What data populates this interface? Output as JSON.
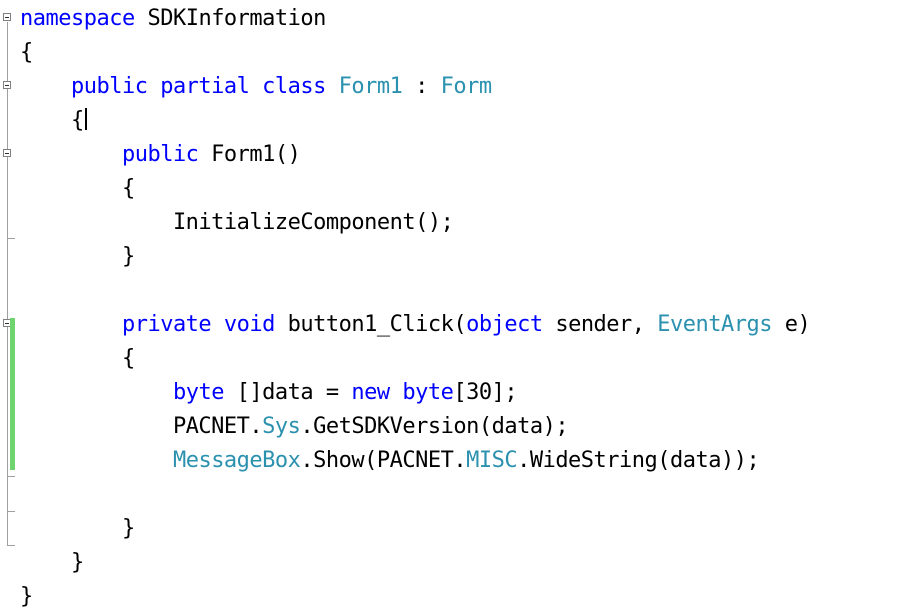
{
  "editor": {
    "lines": [
      {
        "segments": [
          {
            "text": "namespace",
            "kind": "keyword"
          },
          {
            "text": " SDKInformation",
            "kind": "plain"
          }
        ]
      },
      {
        "segments": [
          {
            "text": "{",
            "kind": "plain"
          }
        ]
      },
      {
        "segments": [
          {
            "text": "    public partial class ",
            "kind": "keyword"
          },
          {
            "text": "Form1",
            "kind": "type"
          },
          {
            "text": " : ",
            "kind": "plain"
          },
          {
            "text": "Form",
            "kind": "type"
          }
        ]
      },
      {
        "segments": [
          {
            "text": "    {",
            "kind": "plain"
          }
        ],
        "cursor": true
      },
      {
        "segments": [
          {
            "text": "        public",
            "kind": "keyword"
          },
          {
            "text": " Form1()",
            "kind": "plain"
          }
        ]
      },
      {
        "segments": [
          {
            "text": "        {",
            "kind": "plain"
          }
        ]
      },
      {
        "segments": [
          {
            "text": "            InitializeComponent();",
            "kind": "plain"
          }
        ]
      },
      {
        "segments": [
          {
            "text": "        }",
            "kind": "plain"
          }
        ]
      },
      {
        "segments": [
          {
            "text": "",
            "kind": "plain"
          }
        ]
      },
      {
        "segments": [
          {
            "text": "        private void",
            "kind": "keyword"
          },
          {
            "text": " button1_Click(",
            "kind": "plain"
          },
          {
            "text": "object",
            "kind": "keyword"
          },
          {
            "text": " sender, ",
            "kind": "plain"
          },
          {
            "text": "EventArgs",
            "kind": "type"
          },
          {
            "text": " e)",
            "kind": "plain"
          }
        ]
      },
      {
        "segments": [
          {
            "text": "        {",
            "kind": "plain"
          }
        ]
      },
      {
        "segments": [
          {
            "text": "            ",
            "kind": "plain"
          },
          {
            "text": "byte",
            "kind": "keyword"
          },
          {
            "text": " []data = ",
            "kind": "plain"
          },
          {
            "text": "new byte",
            "kind": "keyword"
          },
          {
            "text": "[30];",
            "kind": "plain"
          }
        ]
      },
      {
        "segments": [
          {
            "text": "            PACNET.",
            "kind": "plain"
          },
          {
            "text": "Sys",
            "kind": "type"
          },
          {
            "text": ".GetSDKVersion(data);",
            "kind": "plain"
          }
        ]
      },
      {
        "segments": [
          {
            "text": "            ",
            "kind": "plain"
          },
          {
            "text": "MessageBox",
            "kind": "type"
          },
          {
            "text": ".Show(PACNET.",
            "kind": "plain"
          },
          {
            "text": "MISC",
            "kind": "type"
          },
          {
            "text": ".WideString(data));",
            "kind": "plain"
          }
        ]
      },
      {
        "segments": [
          {
            "text": "",
            "kind": "plain"
          }
        ]
      },
      {
        "segments": [
          {
            "text": "        }",
            "kind": "plain"
          }
        ]
      },
      {
        "segments": [
          {
            "text": "    }",
            "kind": "plain"
          }
        ]
      },
      {
        "segments": [
          {
            "text": "}",
            "kind": "plain"
          }
        ]
      }
    ]
  },
  "colors": {
    "keyword": "#0000ff",
    "type": "#2b91af",
    "plain": "#000000",
    "change_bar": "#6fd36f"
  }
}
